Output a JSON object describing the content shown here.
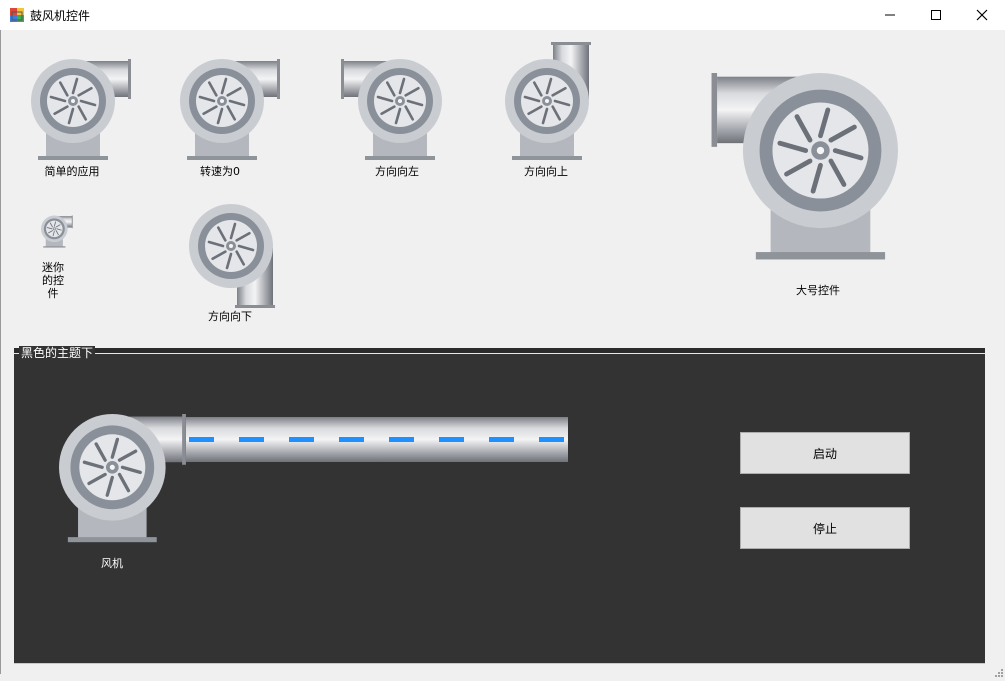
{
  "window": {
    "title": "鼓风机控件",
    "minimize_icon": "minimize-icon",
    "maximize_icon": "maximize-icon",
    "close_icon": "close-icon"
  },
  "fans": [
    {
      "label": "简单的应用",
      "direction": "right"
    },
    {
      "label": "转速为0",
      "direction": "right"
    },
    {
      "label": "方向向左",
      "direction": "left"
    },
    {
      "label": "方向向上",
      "direction": "up"
    },
    {
      "label": "迷你的控件",
      "label_lines": [
        "迷你",
        "的控",
        "件"
      ],
      "direction": "right"
    },
    {
      "label": "方向向下",
      "direction": "down"
    },
    {
      "label": "大号控件",
      "direction": "left"
    }
  ],
  "dark_group": {
    "title": "黑色的主题下",
    "fan_label": "风机",
    "start_button": "启动",
    "stop_button": "停止"
  },
  "colors": {
    "panel_bg": "#333333",
    "flow_dash": "#1e90ff",
    "fan_ring": "#c9ccd1",
    "fan_inner": "#8a9099"
  }
}
